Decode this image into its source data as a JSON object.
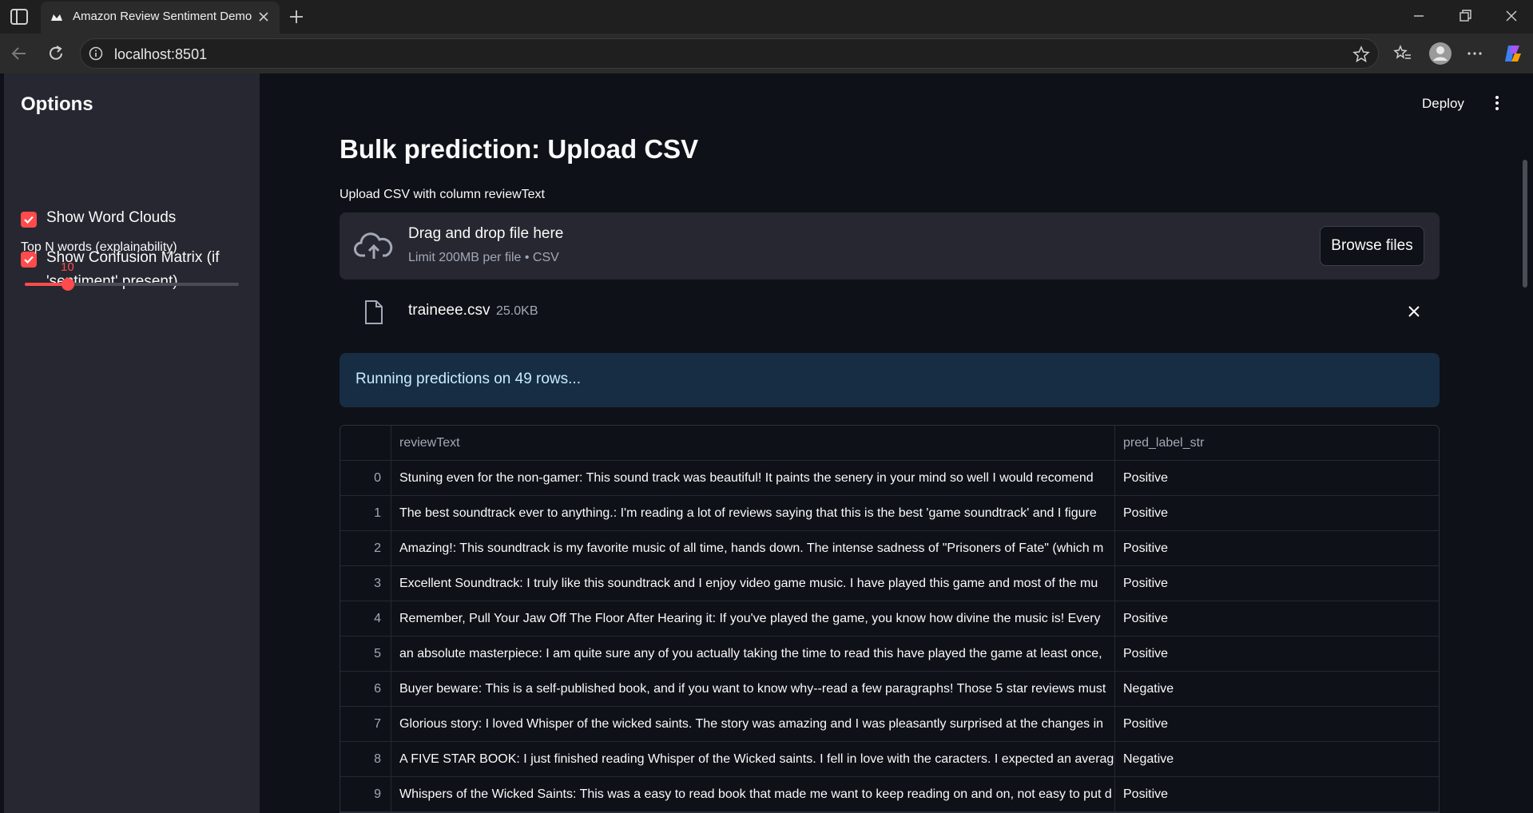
{
  "browser": {
    "tab_title": "Amazon Review Sentiment Demo",
    "url": "localhost:8501"
  },
  "sidebar": {
    "title": "Options",
    "checkboxes": [
      {
        "label": "Show Word Clouds",
        "checked": true
      },
      {
        "label": "Show Confusion Matrix (if 'sentiment' present)",
        "checked": true
      }
    ],
    "slider": {
      "label": "Top N words (explainability)",
      "value": "10",
      "fraction": 0.2
    }
  },
  "header": {
    "deploy_label": "Deploy"
  },
  "main": {
    "title": "Bulk prediction: Upload CSV",
    "uploader_label": "Upload CSV with column reviewText",
    "dropzone_text": "Drag and drop file here",
    "dropzone_limit": "Limit 200MB per file • CSV",
    "browse_label": "Browse files",
    "file_name": "traineee.csv",
    "file_size": "25.0KB",
    "info_message": "Running predictions on 49 rows..."
  },
  "table": {
    "columns": [
      "",
      "reviewText",
      "pred_label_str"
    ],
    "rows": [
      {
        "idx": "0",
        "text": "Stuning even for the non-gamer: This sound track was beautiful! It paints the senery in your mind so well I would recomend",
        "label": "Positive"
      },
      {
        "idx": "1",
        "text": "The best soundtrack ever to anything.: I'm reading a lot of reviews saying that this is the best 'game soundtrack' and I figure",
        "label": "Positive"
      },
      {
        "idx": "2",
        "text": "Amazing!: This soundtrack is my favorite music of all time, hands down. The intense sadness of \"Prisoners of Fate\" (which m",
        "label": "Positive"
      },
      {
        "idx": "3",
        "text": "Excellent Soundtrack: I truly like this soundtrack and I enjoy video game music. I have played this game and most of the mu",
        "label": "Positive"
      },
      {
        "idx": "4",
        "text": "Remember, Pull Your Jaw Off The Floor After Hearing it: If you've played the game, you know how divine the music is! Every",
        "label": "Positive"
      },
      {
        "idx": "5",
        "text": "an absolute masterpiece: I am quite sure any of you actually taking the time to read this have played the game at least once,",
        "label": "Positive"
      },
      {
        "idx": "6",
        "text": "Buyer beware: This is a self-published book, and if you want to know why--read a few paragraphs! Those 5 star reviews must",
        "label": "Negative"
      },
      {
        "idx": "7",
        "text": "Glorious story: I loved Whisper of the wicked saints. The story was amazing and I was pleasantly surprised at the changes in",
        "label": "Positive"
      },
      {
        "idx": "8",
        "text": "A FIVE STAR BOOK: I just finished reading Whisper of the Wicked saints. I fell in love with the caracters. I expected an average",
        "label": "Negative"
      },
      {
        "idx": "9",
        "text": "Whispers of the Wicked Saints: This was a easy to read book that made me want to keep reading on and on, not easy to put d",
        "label": "Positive"
      }
    ]
  }
}
